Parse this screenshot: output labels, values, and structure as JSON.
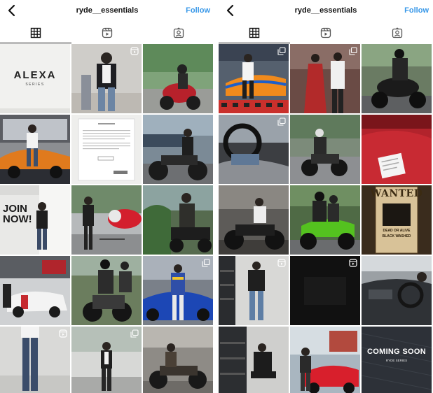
{
  "header": {
    "username": "ryde__essentials",
    "follow_label": "Follow"
  },
  "icons": {
    "back": "chevron-left-icon",
    "grid_tab": "grid-icon",
    "reels_tab": "reels-icon",
    "tagged_tab": "tagged-icon",
    "reel_badge": "reel-badge-icon",
    "multi_badge": "multi-photo-icon"
  },
  "colors": {
    "follow_blue": "#3797e8",
    "text": "#111111",
    "background": "#ffffff"
  },
  "tiles_text": {
    "alexa_title": "ALEXA",
    "alexa_sub": "SERIES",
    "join_now_line1": "JOIN",
    "join_now_line2": "NOW!",
    "wanted": "WANTED",
    "dead_or_alive": "DEAD OR ALIVE",
    "black_washed": "BLACK WASHED",
    "coming_soon": "COMING SOON",
    "coming_sub": "RYDE SERIES"
  }
}
